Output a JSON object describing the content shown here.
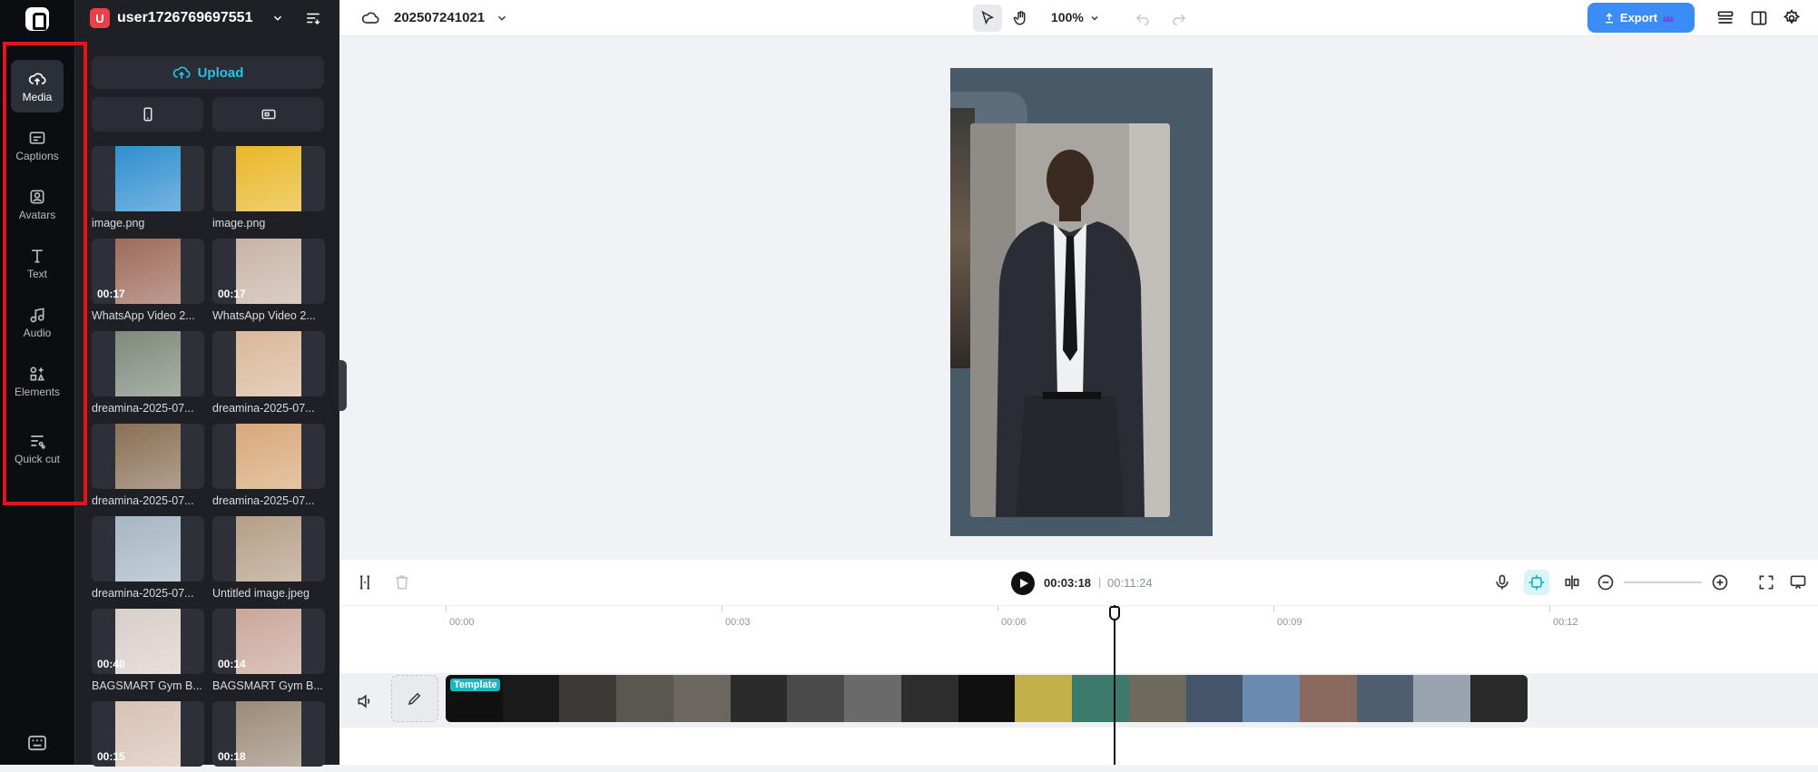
{
  "rail": {
    "items": [
      {
        "label": "Media",
        "icon": "cloud-upload-icon",
        "active": true
      },
      {
        "label": "Captions",
        "icon": "captions-icon"
      },
      {
        "label": "Avatars",
        "icon": "avatar-add-icon"
      },
      {
        "label": "Text",
        "icon": "text-t-icon"
      },
      {
        "label": "Audio",
        "icon": "music-note-icon"
      },
      {
        "label": "Elements",
        "icon": "elements-icon"
      },
      {
        "label": "Quick cut",
        "icon": "quick-cut-icon"
      }
    ],
    "bottom_icon": "keyboard-icon",
    "highlight_color": "#e5141b"
  },
  "panel": {
    "avatar_letter": "U",
    "username": "user1726769697551",
    "upload_label": "Upload",
    "media": [
      {
        "name": "image.png",
        "duration": "",
        "thumb_color": "#2f8fd0"
      },
      {
        "name": "image.png",
        "duration": "",
        "thumb_color": "#e9b728"
      },
      {
        "name": "WhatsApp Video 2...",
        "duration": "00:17",
        "thumb_color": "#9e6b5a"
      },
      {
        "name": "WhatsApp Video 2...",
        "duration": "00:17",
        "thumb_color": "#c9b4a6"
      },
      {
        "name": "dreamina-2025-07...",
        "duration": "",
        "thumb_color": "#7e8a7a"
      },
      {
        "name": "dreamina-2025-07...",
        "duration": "",
        "thumb_color": "#d9b89a"
      },
      {
        "name": "dreamina-2025-07...",
        "duration": "",
        "thumb_color": "#8a6f55"
      },
      {
        "name": "dreamina-2025-07...",
        "duration": "",
        "thumb_color": "#d8a878"
      },
      {
        "name": "dreamina-2025-07...",
        "duration": "",
        "thumb_color": "#a7b6c4"
      },
      {
        "name": "Untitled image.jpeg",
        "duration": "",
        "thumb_color": "#b59e86"
      },
      {
        "name": "BAGSMART Gym B...",
        "duration": "00:40",
        "thumb_color": "#d9cfc9"
      },
      {
        "name": "BAGSMART Gym B...",
        "duration": "00:14",
        "thumb_color": "#caa79a"
      },
      {
        "name": "",
        "duration": "00:15",
        "thumb_color": "#d8c2b5"
      },
      {
        "name": "",
        "duration": "00:18",
        "thumb_color": "#9c8a77"
      }
    ]
  },
  "topbar": {
    "project_title": "202507241021",
    "zoom": "100%",
    "export_label": "Export"
  },
  "timeline": {
    "current_time": "00:03:18",
    "separator": "|",
    "total_time": "00:11:24",
    "ticks": [
      "00:00",
      "00:03",
      "00:06",
      "00:09",
      "00:12"
    ],
    "template_badge": "Template",
    "clip_colors": [
      "#111111",
      "#1a1a1a",
      "#3b3a36",
      "#5a5650",
      "#6b6760",
      "#2b2b2b",
      "#4a4a4a",
      "#6a6a6a",
      "#2d2d2d",
      "#101010",
      "#c2b14a",
      "#3b7a6a",
      "#6e6a5e",
      "#44556a",
      "#6b8ab0",
      "#8a6a5e",
      "#4f5f70",
      "#9aa4b0",
      "#2a2a2a"
    ]
  }
}
